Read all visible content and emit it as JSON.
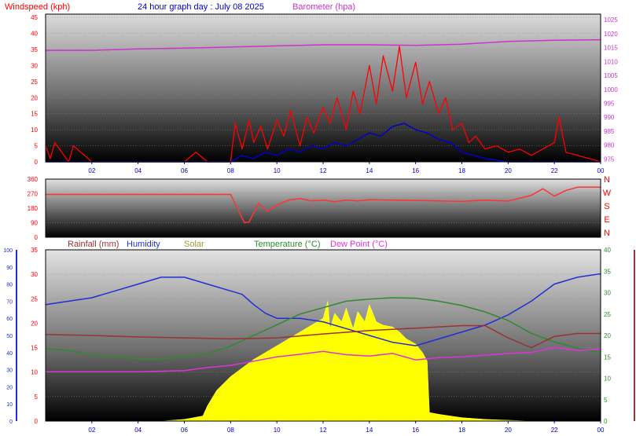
{
  "header": {
    "windspeed_label": "Windspeed (kph)",
    "title": "24 hour graph day : July 08 2025",
    "barometer_label": "Barometer (hpa)"
  },
  "bottom_legend": {
    "rainfall": "Rainfall (mm)",
    "humidity": "Humidity",
    "solar": "Solar",
    "temperature": "Temperature (°C)",
    "dewpoint": "Dew Point (°C)"
  },
  "colors": {
    "wind": "#ff0000",
    "gust": "#0000cc",
    "barometer": "#cc33cc",
    "direction": "#ff3333",
    "rain": "#993333",
    "humidity": "#1f2fd6",
    "solar": "#ffff00",
    "solar_text": "#999933",
    "temperature": "#2f8a2f",
    "dewpoint": "#dd33dd"
  },
  "chart_data": [
    {
      "type": "line",
      "name": "wind-panel",
      "x_ticks": [
        "02",
        "04",
        "06",
        "08",
        "10",
        "12",
        "14",
        "16",
        "18",
        "20",
        "22",
        "00"
      ],
      "y_left_ticks": [
        "0",
        "5",
        "10",
        "15",
        "20",
        "25",
        "30",
        "35",
        "40",
        "45"
      ],
      "y_right_ticks": [
        "975",
        "980",
        "985",
        "990",
        "995",
        "1000",
        "1005",
        "1010",
        "1015",
        "1020",
        "1025"
      ],
      "ylim_left": [
        0,
        46
      ],
      "ylim_right": [
        974,
        1027
      ],
      "xlim": [
        0,
        24
      ],
      "series": [
        {
          "key": "wind_gust",
          "x": [
            0,
            0.2,
            0.4,
            1,
            1.2,
            2,
            3,
            4,
            5,
            6,
            6.5,
            7,
            8,
            8.2,
            8.5,
            8.8,
            9,
            9.3,
            9.6,
            10,
            10.3,
            10.6,
            11,
            11.3,
            11.6,
            12,
            12.3,
            12.6,
            13,
            13.3,
            13.6,
            14,
            14.3,
            14.6,
            15,
            15.3,
            15.6,
            16,
            16.3,
            16.6,
            17,
            17.3,
            17.6,
            18,
            18.3,
            18.6,
            19,
            19.5,
            20,
            20.5,
            21,
            21.5,
            22,
            22.2,
            22.5,
            23,
            24
          ],
          "y": [
            5,
            1,
            6,
            0,
            5,
            0,
            0,
            0,
            0,
            0,
            3,
            0,
            0,
            12,
            4,
            13,
            6,
            11,
            4,
            13,
            8,
            16,
            5,
            14,
            9,
            17,
            12,
            20,
            10,
            22,
            15,
            30,
            18,
            33,
            22,
            36,
            20,
            31,
            18,
            25,
            15,
            20,
            10,
            12,
            6,
            8,
            4,
            5,
            3,
            4,
            2,
            4,
            6,
            14,
            3,
            2,
            0
          ]
        },
        {
          "key": "wind_avg",
          "x": [
            0,
            2,
            4,
            6,
            8,
            8.5,
            9,
            9.5,
            10,
            10.5,
            11,
            11.5,
            12,
            12.5,
            13,
            13.5,
            14,
            14.5,
            15,
            15.5,
            16,
            16.5,
            17,
            17.5,
            18,
            18.5,
            19,
            20,
            22,
            24
          ],
          "y": [
            0,
            0,
            0,
            0,
            0,
            2,
            1,
            3,
            2,
            4,
            3,
            5,
            4,
            6,
            5,
            7,
            9,
            8,
            11,
            12,
            10,
            9,
            7,
            6,
            3,
            2,
            1,
            0,
            0,
            0
          ]
        },
        {
          "key": "barometer",
          "x": [
            0,
            2,
            4,
            6,
            8,
            10,
            12,
            14,
            16,
            18,
            20,
            22,
            24
          ],
          "y": [
            1014,
            1014,
            1014.5,
            1014.8,
            1015.2,
            1015.6,
            1016,
            1016,
            1015.8,
            1016.2,
            1017.2,
            1017.6,
            1017.8
          ]
        }
      ]
    },
    {
      "type": "line",
      "name": "direction-panel",
      "y_ticks": [
        "0",
        "90",
        "180",
        "270",
        "360"
      ],
      "compass": [
        "N",
        "W",
        "S",
        "E",
        "N"
      ],
      "ylim": [
        0,
        360
      ],
      "xlim": [
        0,
        24
      ],
      "series": [
        {
          "key": "direction",
          "x": [
            0,
            1,
            2,
            3,
            4,
            5,
            6,
            7,
            8,
            8.6,
            8.8,
            9.2,
            9.6,
            10,
            10.5,
            11,
            11.5,
            12,
            12.5,
            13,
            13.5,
            14,
            15,
            16,
            17,
            18,
            19,
            20,
            21,
            21.5,
            22,
            22.5,
            23,
            23.5,
            24
          ],
          "y": [
            265,
            265,
            265,
            265,
            265,
            265,
            265,
            265,
            265,
            90,
            95,
            210,
            160,
            200,
            230,
            240,
            225,
            230,
            220,
            230,
            225,
            232,
            230,
            228,
            225,
            222,
            230,
            224,
            260,
            300,
            255,
            290,
            310,
            310,
            310
          ]
        }
      ]
    },
    {
      "type": "line",
      "name": "weather-panel",
      "x_ticks": [
        "02",
        "04",
        "06",
        "08",
        "10",
        "12",
        "14",
        "16",
        "18",
        "20",
        "22",
        "00"
      ],
      "y_humidity_ticks": [
        "0",
        "10",
        "20",
        "30",
        "40",
        "50",
        "60",
        "70",
        "80",
        "90",
        "100"
      ],
      "y_rain_ticks": [
        "0",
        "5",
        "10",
        "15",
        "20",
        "25",
        "30",
        "35"
      ],
      "y_temp_ticks": [
        "0",
        "5",
        "10",
        "15",
        "20",
        "25",
        "30",
        "35",
        "40"
      ],
      "ylim_humidity": [
        0,
        100
      ],
      "ylim_rain": [
        0,
        35
      ],
      "ylim_temp": [
        0,
        40
      ],
      "xlim": [
        0,
        24
      ],
      "series": [
        {
          "key": "humidity",
          "x": [
            0,
            1,
            2,
            3,
            4,
            5,
            6,
            7,
            8,
            8.5,
            9,
            9.5,
            10,
            11,
            12,
            13,
            14,
            15,
            16,
            17,
            18,
            19,
            20,
            21,
            22,
            23,
            24
          ],
          "y": [
            68,
            70,
            72,
            76,
            80,
            84,
            84,
            80,
            76,
            74,
            68,
            63,
            60,
            60,
            58,
            54,
            50,
            46,
            44,
            48,
            52,
            56,
            62,
            70,
            80,
            84,
            86
          ]
        },
        {
          "key": "temperature",
          "x": [
            0,
            1,
            2,
            3,
            4,
            5,
            6,
            7,
            8,
            9,
            10,
            11,
            12,
            13,
            14,
            15,
            16,
            17,
            18,
            19,
            20,
            21,
            22,
            23,
            24
          ],
          "y": [
            17,
            16.5,
            15.5,
            15,
            14.5,
            14.5,
            15,
            15.8,
            17.5,
            20,
            22.5,
            25,
            26.5,
            28,
            28.5,
            28.8,
            28.7,
            28,
            27,
            25.5,
            23.5,
            20.5,
            18.5,
            17,
            16
          ]
        },
        {
          "key": "dewpoint",
          "x": [
            0,
            2,
            4,
            6,
            7,
            8,
            9,
            10,
            11,
            12,
            13,
            14,
            15,
            16,
            17,
            18,
            19,
            20,
            21,
            22,
            23,
            24
          ],
          "y": [
            11.5,
            11.5,
            11.5,
            11.8,
            12.5,
            13,
            14,
            15,
            15.6,
            16.3,
            15.5,
            15.2,
            15.8,
            14.3,
            14.8,
            15,
            15.4,
            15.8,
            16,
            17.2,
            16.5,
            16.8
          ]
        },
        {
          "key": "rainfall",
          "x": [
            0,
            2,
            4,
            6,
            8,
            10,
            12,
            14,
            16,
            18,
            19,
            20,
            21,
            22,
            23,
            24
          ],
          "y": [
            17.7,
            17.5,
            17.2,
            17,
            16.8,
            17,
            17.8,
            18.5,
            19,
            19.5,
            19.5,
            17,
            15,
            17.3,
            17.9,
            17.9
          ]
        },
        {
          "key": "solar",
          "x": [
            0,
            5,
            6,
            6.8,
            7,
            7.4,
            8,
            8.5,
            9,
            9.5,
            10,
            10.5,
            11,
            11.5,
            12,
            12.2,
            12.3,
            12.5,
            12.8,
            13,
            13.3,
            13.5,
            13.8,
            14,
            14.3,
            14.6,
            15,
            15.3,
            15.6,
            16,
            16.3,
            16.5,
            16.6,
            17,
            17.5,
            18,
            19,
            20,
            21,
            22,
            23,
            24
          ],
          "y": [
            0,
            0,
            1,
            3,
            9,
            18,
            26,
            31,
            36,
            40,
            44,
            48,
            52,
            56,
            60,
            70,
            54,
            63,
            58,
            66,
            54,
            64,
            58,
            68,
            58,
            56,
            55,
            52,
            48,
            45,
            40,
            35,
            5,
            4,
            3,
            2,
            1,
            0.5,
            0,
            0,
            0,
            0
          ]
        }
      ]
    }
  ]
}
